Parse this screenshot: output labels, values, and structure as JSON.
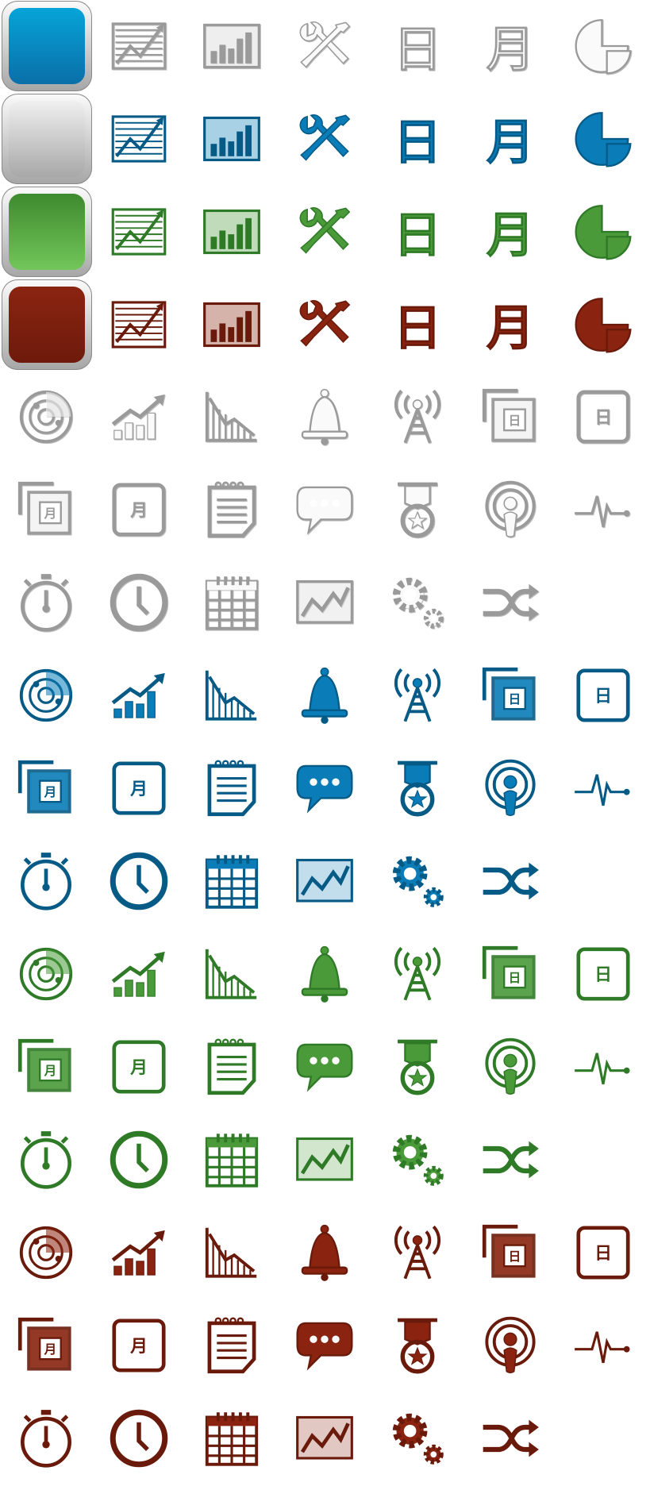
{
  "palettes": {
    "emboss": {
      "fill": "#fafafa",
      "stroke": "#9a9a9a"
    },
    "blue": {
      "fill": "#0a7db8",
      "stroke": "#065a86"
    },
    "green": {
      "fill": "#4a9a3a",
      "stroke": "#2f7a26"
    },
    "red": {
      "fill": "#8a2410",
      "stroke": "#6a1a0a"
    }
  },
  "tiles": [
    {
      "name": "blue-tile",
      "top": "#06a4d8",
      "bottom": "#0a6fa8"
    },
    {
      "name": "silver-tile",
      "top": "#f0f0f0",
      "bottom": "#a8a8a8"
    },
    {
      "name": "green-tile",
      "top": "#3e8a2e",
      "bottom": "#72c65a"
    },
    {
      "name": "red-tile",
      "top": "#8a2410",
      "bottom": "#6e1a0c"
    }
  ],
  "glyphs": {
    "day": "日",
    "month": "月"
  },
  "set_a_rows": [
    {
      "palette": "emboss",
      "tile": 0
    },
    {
      "palette": "blue",
      "tile": 1
    },
    {
      "palette": "green",
      "tile": 2
    },
    {
      "palette": "red",
      "tile": 3
    }
  ],
  "set_a_icons": [
    "line-chart-icon",
    "bar-chart-icon",
    "tools-icon",
    "day-glyph-icon",
    "month-glyph-icon",
    "pie-chart-icon"
  ],
  "set_b_rows": [
    [
      "radar-icon",
      "trend-up-icon",
      "trend-down-icon",
      "bell-icon",
      "radio-tower-icon",
      "stacked-day-icon",
      "day-card-icon"
    ],
    [
      "stacked-month-icon",
      "month-card-icon",
      "notepad-icon",
      "chat-bubble-icon",
      "medal-icon",
      "podcast-icon",
      "pulse-icon"
    ],
    [
      "stopwatch-icon",
      "clock-icon",
      "calendar-icon",
      "chart-board-icon",
      "gears-icon",
      "shuffle-icon"
    ]
  ],
  "set_b_palettes": [
    "emboss",
    "blue",
    "green",
    "red"
  ]
}
